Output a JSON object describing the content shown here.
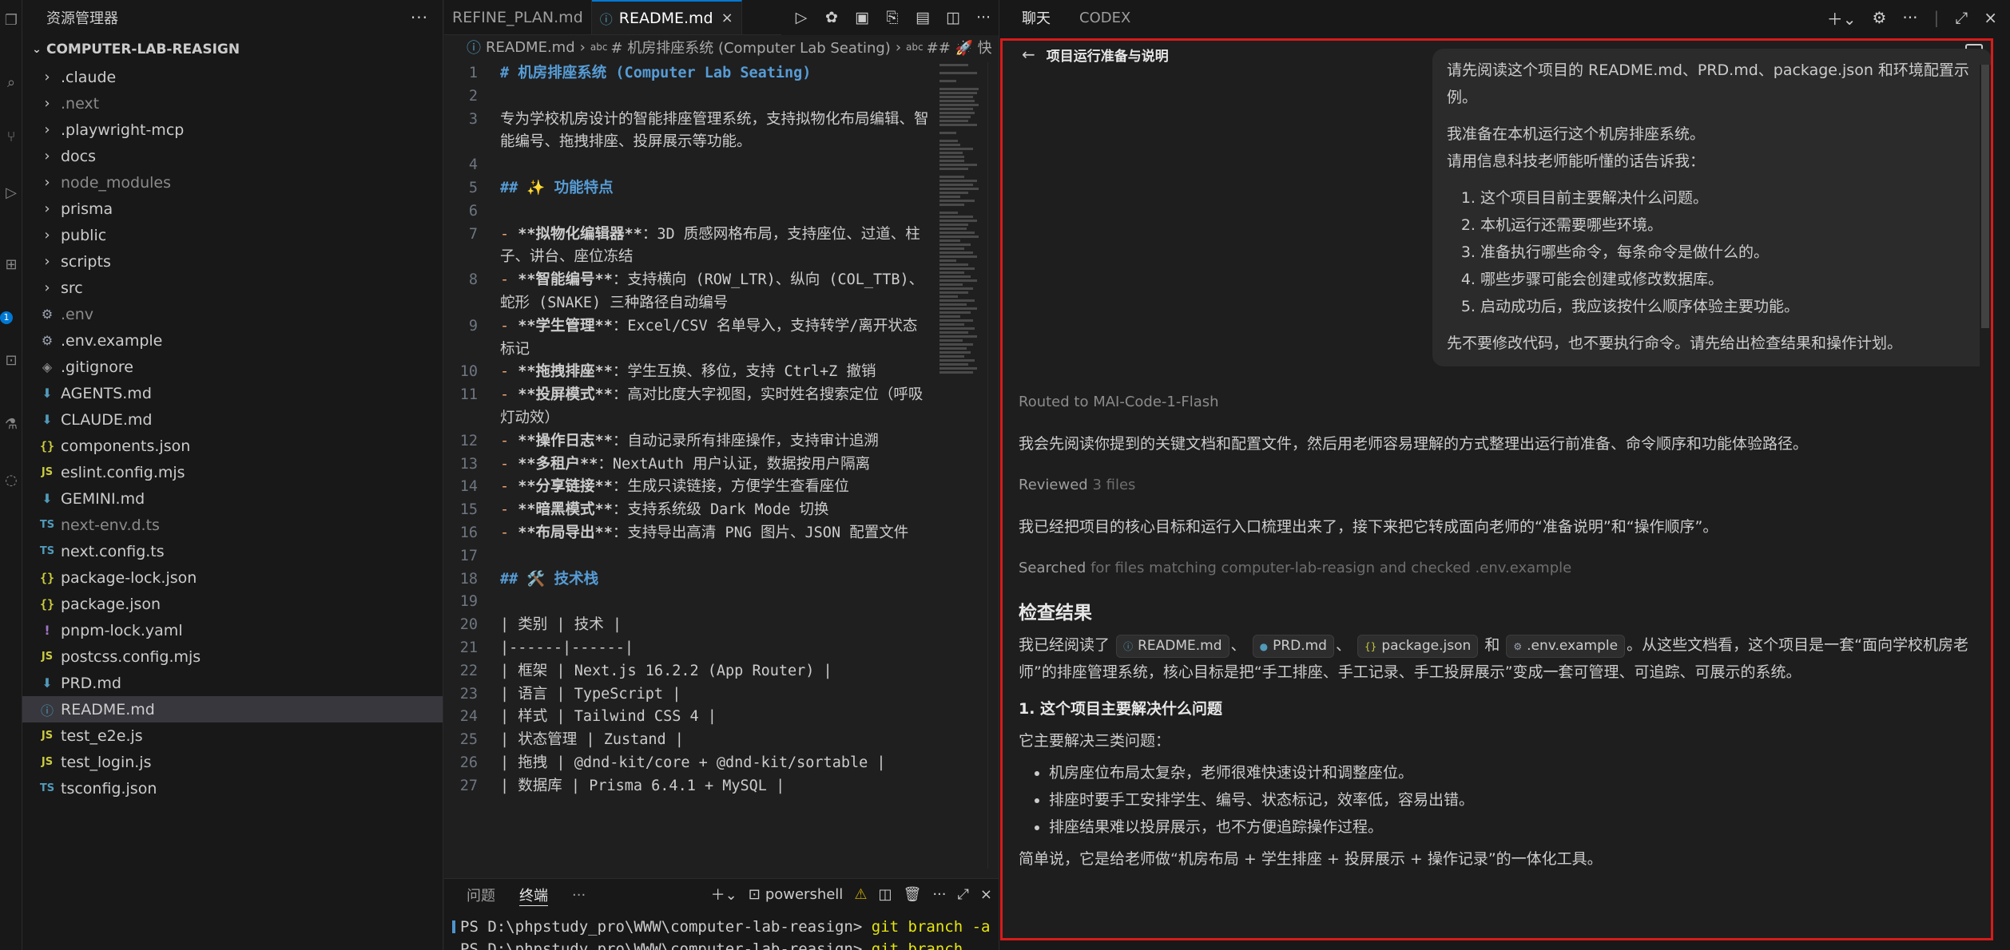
{
  "activity": {
    "badge": "1"
  },
  "explorer": {
    "title": "资源管理器",
    "project": "COMPUTER-LAB-REASIGN",
    "items": [
      {
        "label": ".claude",
        "kind": "folder",
        "icon": "chevron-right-icon"
      },
      {
        "label": ".next",
        "kind": "folder",
        "icon": "chevron-right-icon",
        "dim": true
      },
      {
        "label": ".playwright-mcp",
        "kind": "folder",
        "icon": "chevron-right-icon"
      },
      {
        "label": "docs",
        "kind": "folder",
        "icon": "chevron-right-icon"
      },
      {
        "label": "node_modules",
        "kind": "folder",
        "icon": "chevron-right-icon",
        "dim": true
      },
      {
        "label": "prisma",
        "kind": "folder",
        "icon": "chevron-right-icon"
      },
      {
        "label": "public",
        "kind": "folder",
        "icon": "chevron-right-icon"
      },
      {
        "label": "scripts",
        "kind": "folder",
        "icon": "chevron-right-icon"
      },
      {
        "label": "src",
        "kind": "folder",
        "icon": "chevron-right-icon"
      },
      {
        "label": ".env",
        "kind": "gear",
        "icon": "gear-file-icon",
        "dim": true
      },
      {
        "label": ".env.example",
        "kind": "gear",
        "icon": "gear-file-icon"
      },
      {
        "label": ".gitignore",
        "kind": "git",
        "icon": "git-file-icon"
      },
      {
        "label": "AGENTS.md",
        "kind": "md",
        "icon": "markdown-file-icon"
      },
      {
        "label": "CLAUDE.md",
        "kind": "md",
        "icon": "markdown-file-icon"
      },
      {
        "label": "components.json",
        "kind": "json",
        "icon": "json-file-icon"
      },
      {
        "label": "eslint.config.mjs",
        "kind": "js",
        "icon": "js-file-icon"
      },
      {
        "label": "GEMINI.md",
        "kind": "md",
        "icon": "markdown-file-icon"
      },
      {
        "label": "next-env.d.ts",
        "kind": "ts",
        "icon": "ts-file-icon",
        "dim": true
      },
      {
        "label": "next.config.ts",
        "kind": "ts",
        "icon": "ts-file-icon"
      },
      {
        "label": "package-lock.json",
        "kind": "json",
        "icon": "json-file-icon"
      },
      {
        "label": "package.json",
        "kind": "json",
        "icon": "json-file-icon"
      },
      {
        "label": "pnpm-lock.yaml",
        "kind": "yaml",
        "icon": "yaml-file-icon"
      },
      {
        "label": "postcss.config.mjs",
        "kind": "js",
        "icon": "js-file-icon"
      },
      {
        "label": "PRD.md",
        "kind": "md",
        "icon": "markdown-file-icon"
      },
      {
        "label": "README.md",
        "kind": "info",
        "icon": "info-file-icon",
        "selected": true
      },
      {
        "label": "test_e2e.js",
        "kind": "js",
        "icon": "js-file-icon"
      },
      {
        "label": "test_login.js",
        "kind": "js",
        "icon": "js-file-icon"
      },
      {
        "label": "tsconfig.json",
        "kind": "ts",
        "icon": "tsconfig-file-icon"
      }
    ]
  },
  "editor": {
    "tabs": [
      {
        "label": "REFINE_PLAN.md",
        "active": false
      },
      {
        "label": "README.md",
        "active": true
      }
    ],
    "breadcrumb": {
      "file": "README.md",
      "section": "# 机房排座系统 (Computer Lab Seating)",
      "subsection": "## 🚀 快"
    },
    "lines": [
      {
        "n": "1",
        "text": "# 机房排座系统 (Computer Lab Seating)",
        "style": "h1"
      },
      {
        "n": "2",
        "text": "",
        "style": ""
      },
      {
        "n": "3",
        "text": "专为学校机房设计的智能排座管理系统，支持拟物化布局编辑、智能编号、拖拽排座、投屏展示等功能。",
        "style": ""
      },
      {
        "n": "4",
        "text": "",
        "style": ""
      },
      {
        "n": "5",
        "text": "## ✨ 功能特点",
        "style": "h1"
      },
      {
        "n": "6",
        "text": "",
        "style": ""
      },
      {
        "n": "7",
        "bullet": "- ",
        "bold": "**拟物化编辑器**",
        "text": "：3D 质感网格布局，支持座位、过道、柱子、讲台、座位冻结",
        "style": "b"
      },
      {
        "n": "8",
        "bullet": "- ",
        "bold": "**智能编号**",
        "text": "：支持横向 (ROW_LTR)、纵向 (COL_TTB)、蛇形 (SNAKE) 三种路径自动编号",
        "style": "b"
      },
      {
        "n": "9",
        "bullet": "- ",
        "bold": "**学生管理**",
        "text": "：Excel/CSV 名单导入，支持转学/离开状态标记",
        "style": "b"
      },
      {
        "n": "10",
        "bullet": "- ",
        "bold": "**拖拽排座**",
        "text": "：学生互换、移位，支持 Ctrl+Z 撤销",
        "style": "b"
      },
      {
        "n": "11",
        "bullet": "- ",
        "bold": "**投屏模式**",
        "text": "：高对比度大字视图，实时姓名搜索定位（呼吸灯动效）",
        "style": "b"
      },
      {
        "n": "12",
        "bullet": "- ",
        "bold": "**操作日志**",
        "text": "：自动记录所有排座操作，支持审计追溯",
        "style": "b"
      },
      {
        "n": "13",
        "bullet": "- ",
        "bold": "**多租户**",
        "text": "：NextAuth 用户认证，数据按用户隔离",
        "style": "b"
      },
      {
        "n": "14",
        "bullet": "- ",
        "bold": "**分享链接**",
        "text": "：生成只读链接，方便学生查看座位",
        "style": "b"
      },
      {
        "n": "15",
        "bullet": "- ",
        "bold": "**暗黑模式**",
        "text": "：支持系统级 Dark Mode 切换",
        "style": "b"
      },
      {
        "n": "16",
        "bullet": "- ",
        "bold": "**布局导出**",
        "text": "：支持导出高清 PNG 图片、JSON 配置文件",
        "style": "b"
      },
      {
        "n": "17",
        "text": "",
        "style": ""
      },
      {
        "n": "18",
        "text": "## 🛠️ 技术栈",
        "style": "h1"
      },
      {
        "n": "19",
        "text": "",
        "style": ""
      },
      {
        "n": "20",
        "text": "| 类别 | 技术 |",
        "style": ""
      },
      {
        "n": "21",
        "text": "|------|------|",
        "style": ""
      },
      {
        "n": "22",
        "text": "| 框架 | Next.js 16.2.2 (App Router) |",
        "style": ""
      },
      {
        "n": "23",
        "text": "| 语言 | TypeScript |",
        "style": ""
      },
      {
        "n": "24",
        "text": "| 样式 | Tailwind CSS 4 |",
        "style": ""
      },
      {
        "n": "25",
        "text": "| 状态管理 | Zustand |",
        "style": ""
      },
      {
        "n": "26",
        "text": "| 拖拽 | @dnd-kit/core + @dnd-kit/sortable |",
        "style": ""
      },
      {
        "n": "27",
        "text": "| 数据库 | Prisma 6.4.1 + MySQL |",
        "style": ""
      }
    ]
  },
  "panel": {
    "tabs": [
      "问题",
      "终端"
    ],
    "shell": "powershell",
    "terminal": {
      "prompt": "PS D:\\phpstudy_pro\\WWW\\computer-lab-reasign> ",
      "command": "git branch -a",
      "prompt2": "PS D:\\phpstudy_pro\\WWW\\computer-lab-reasign> ",
      "command2": "git branch"
    }
  },
  "chat": {
    "tabs": [
      "聊天",
      "CODEX"
    ],
    "title": "项目运行准备与说明",
    "user_message": {
      "intro": "请先阅读这个项目的 README.md、PRD.md、package.json 和环境配置示例。",
      "line1": "我准备在本机运行这个机房排座系统。",
      "line2": "请用信息科技老师能听懂的话告诉我：",
      "items": [
        "这个项目目前主要解决什么问题。",
        "本机运行还需要哪些环境。",
        "准备执行哪些命令，每条命令是做什么的。",
        "哪些步骤可能会创建或修改数据库。",
        "启动成功后，我应该按什么顺序体验主要功能。"
      ],
      "outro": "先不要修改代码，也不要执行命令。请先给出检查结果和操作计划。"
    },
    "assistant": {
      "routed": "Routed to MAI-Code-1-Flash",
      "p1": "我会先阅读你提到的关键文档和配置文件，然后用老师容易理解的方式整理出运行前准备、命令顺序和功能体验路径。",
      "reviewed_a": "Reviewed",
      "reviewed_b": "3 files",
      "p2": "我已经把项目的核心目标和运行入口梳理出来了，接下来把它转成面向老师的“准备说明”和“操作顺序”。",
      "searched_a": "Searched",
      "searched_b": "for files matching computer-lab-reasign and checked .env.example",
      "heading": "检查结果",
      "read_prefix": "我已经阅读了",
      "chip1": "README.md",
      "chip2": "PRD.md",
      "chip3": "package.json",
      "chip4": ".env.example",
      "sep1": "、",
      "sep2": "、",
      "sep3": "和",
      "read_suffix": "。从这些文档看，这个项目是一套“面向学校机房老师”的排座管理系统，核心目标是把“手工排座、手工记录、手工投屏展示”变成一套可管理、可追踪、可展示的系统。",
      "sub1": "1. 这个项目主要解决什么问题",
      "sub1_intro": "它主要解决三类问题：",
      "bullets": [
        "机房座位布局太复杂，老师很难快速设计和调整座位。",
        "排座时要手工安排学生、编号、状态标记，效率低，容易出错。",
        "排座结果难以投屏展示，也不方便追踪操作过程。"
      ],
      "summary": "简单说，它是给老师做“机房布局 + 学生排座 + 投屏展示 + 操作记录”的一体化工具。"
    }
  },
  "colors": {
    "accent": "#0078d4",
    "highlight_border": "#d81b1b",
    "heading_blue": "#569cd6",
    "bullet_orange": "#f0a070"
  }
}
